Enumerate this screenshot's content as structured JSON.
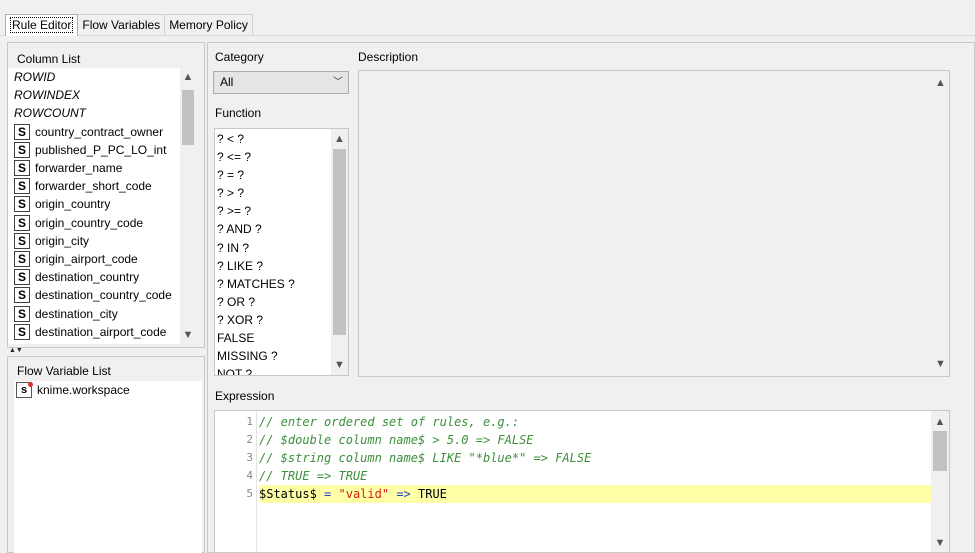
{
  "tabs": [
    "Rule Editor",
    "Flow Variables",
    "Memory Policy"
  ],
  "column_list": {
    "title": "Column List",
    "special_items": [
      "ROWID",
      "ROWINDEX",
      "ROWCOUNT"
    ],
    "type_glyph": "S",
    "items": [
      "country_contract_owner",
      "published_P_PC_LO_int",
      "forwarder_name",
      "forwarder_short_code",
      "origin_country",
      "origin_country_code",
      "origin_city",
      "origin_airport_code",
      "destination_country",
      "destination_country_code",
      "destination_city",
      "destination_airport_code"
    ]
  },
  "flow_variable_list": {
    "title": "Flow Variable List",
    "type_glyph": "s",
    "items": [
      "knime.workspace"
    ]
  },
  "category": {
    "label": "Category",
    "selected": "All"
  },
  "function": {
    "label": "Function",
    "items": [
      "? < ?",
      "? <= ?",
      "? = ?",
      "? > ?",
      "? >= ?",
      "? AND ?",
      "? IN ?",
      "? LIKE ?",
      "? MATCHES ?",
      "? OR ?",
      "? XOR ?",
      "FALSE",
      "MISSING ?",
      "NOT ?"
    ]
  },
  "description": {
    "label": "Description"
  },
  "expression": {
    "label": "Expression",
    "lines": [
      {
        "n": "1",
        "text": "// enter ordered set of rules, e.g.:"
      },
      {
        "n": "2",
        "text": "// $double column name$ > 5.0 => FALSE"
      },
      {
        "n": "3",
        "text": "// $string column name$ LIKE \"*blue*\" => FALSE"
      },
      {
        "n": "4",
        "text": "// TRUE => TRUE"
      },
      {
        "n": "5",
        "parts": [
          "$Status$",
          " ",
          "=",
          " ",
          "\"valid\"",
          " ",
          "=>",
          " TRUE"
        ]
      }
    ]
  },
  "colors": {
    "comment": "#3b8f3b",
    "string": "#d0211c",
    "operator": "#2346c8",
    "highlight": "#ffffa8"
  },
  "icons": {
    "scroll_up": "▲",
    "scroll_down": "▼",
    "dropdown": "chevron-down-icon"
  }
}
